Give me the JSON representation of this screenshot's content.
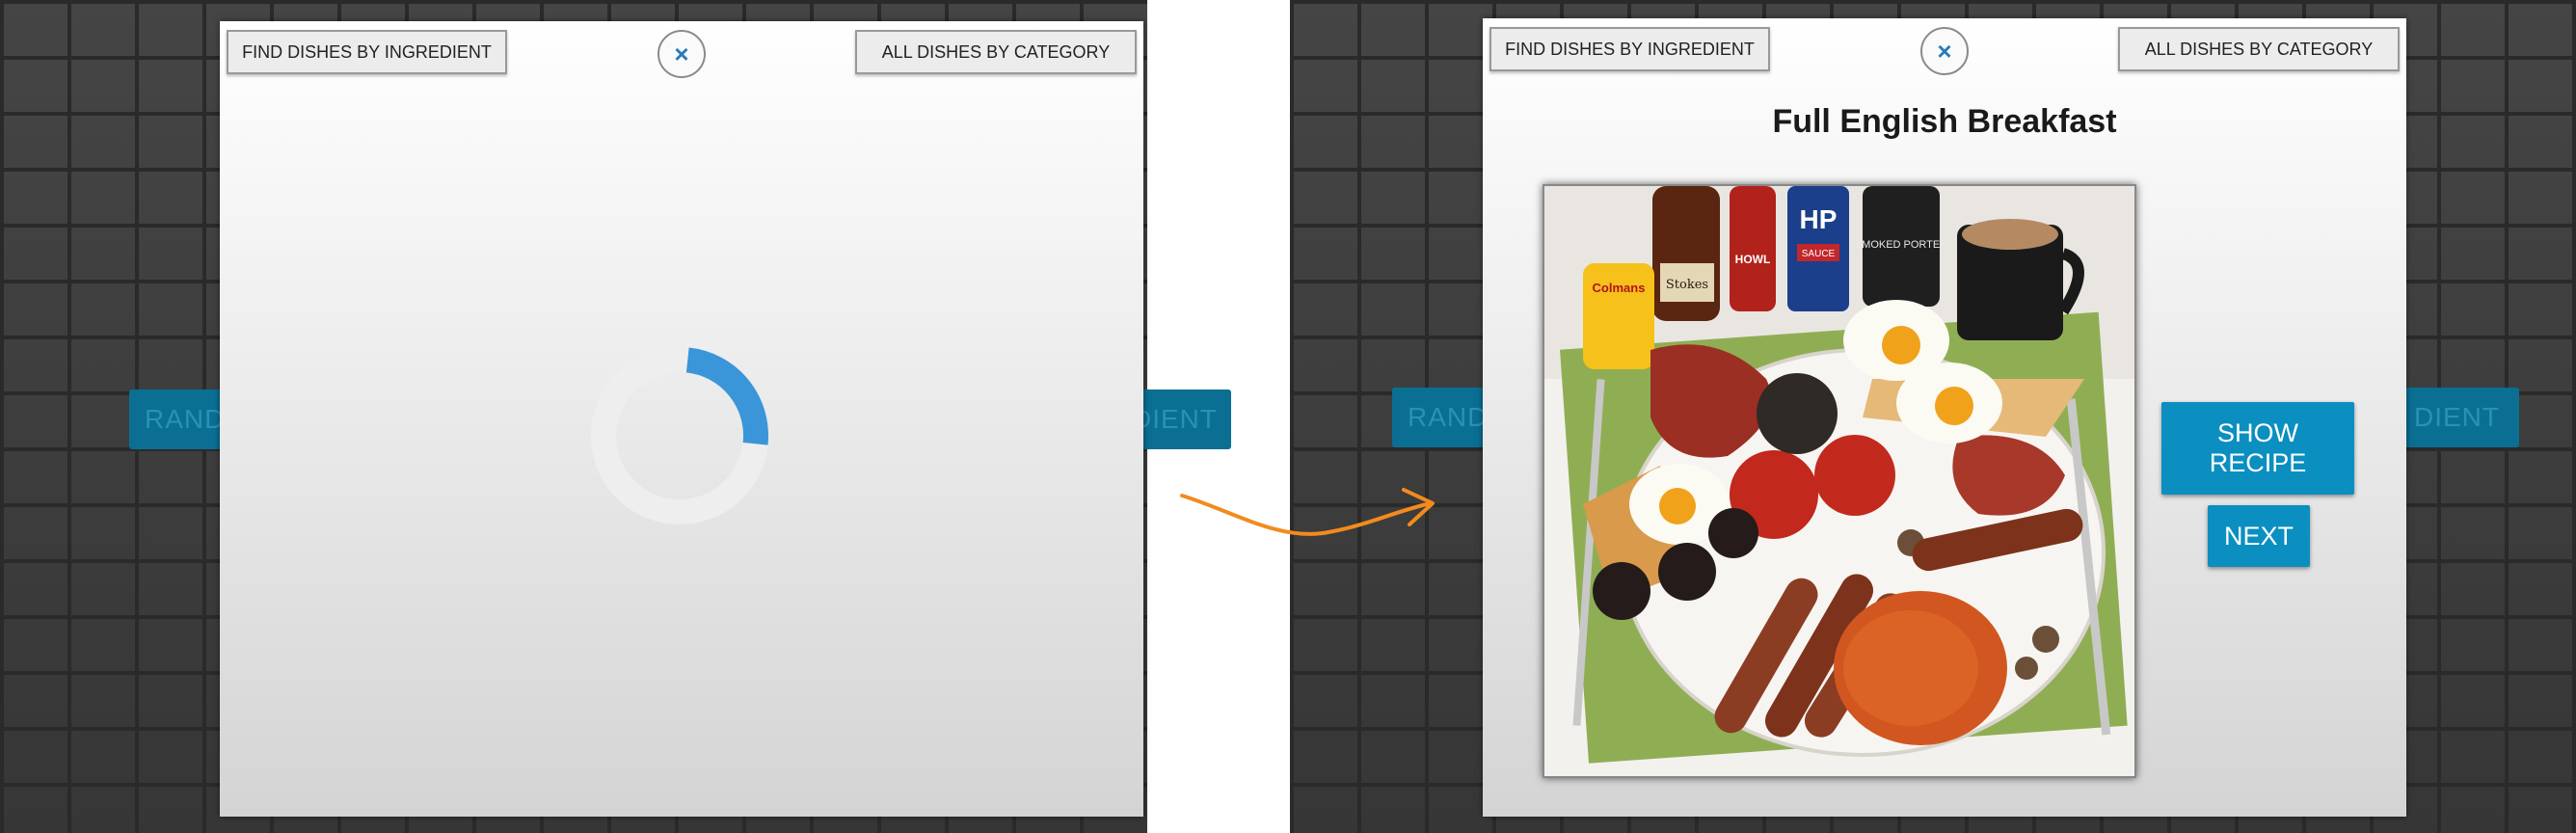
{
  "background": {
    "random_button_label": "RANDOM",
    "ingredient_button_label": "BY INGREDIENT",
    "left_random_visible": "RAND",
    "left_ingredient_visible": "DIENT",
    "right_random_visible": "RAND",
    "right_ingredient_visible": "DIENT"
  },
  "loading_panel": {
    "ingredient_button": "FIND DISHES BY INGREDIENT",
    "category_button": "ALL DISHES BY CATEGORY",
    "close_icon": "×",
    "spinner_progress": 0.25
  },
  "result_panel": {
    "ingredient_button": "FIND DISHES BY INGREDIENT",
    "category_button": "ALL DISHES BY CATEGORY",
    "close_icon": "×",
    "dish_title": "Full English Breakfast",
    "show_recipe_button": "SHOW\nRECIPE",
    "next_button": "NEXT",
    "photo_labels": {
      "mustard": "Colmans",
      "sauce_bottle": "Stokes",
      "hp_sauce": "HP",
      "hp_sub": "SAUCE",
      "porter": "SMOKED PORTER",
      "hot_sauce": "HOWL"
    }
  },
  "colors": {
    "accent_blue": "#0a8fc0",
    "spinner_blue": "#3a96d8",
    "spinner_track": "#eeeeee",
    "arrow_orange": "#f28b1e"
  }
}
